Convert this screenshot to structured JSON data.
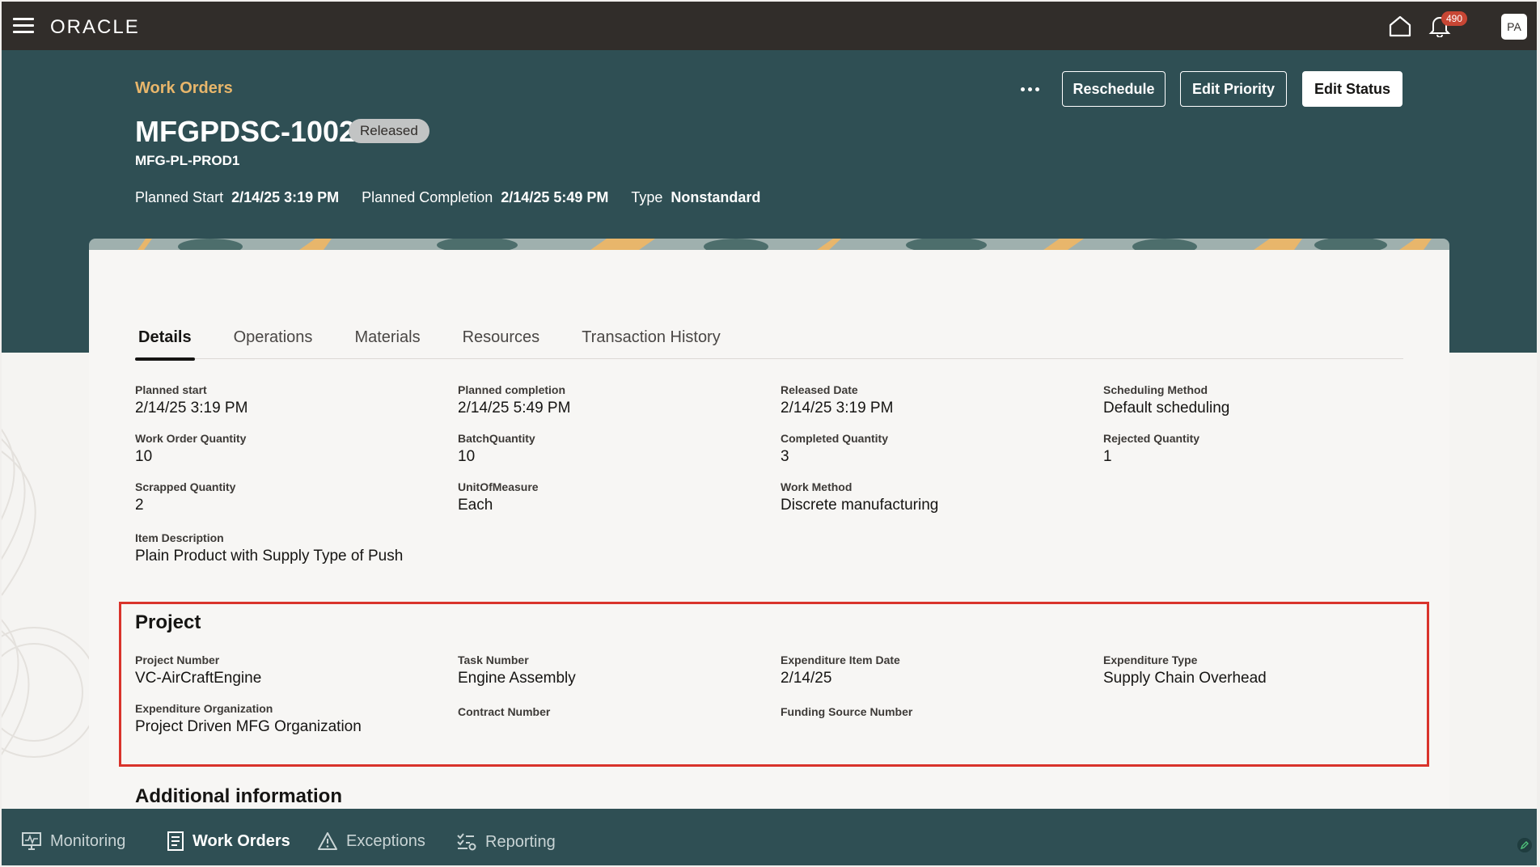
{
  "app": {
    "logo": "ORACLE",
    "notifications_count": "490",
    "user_initials": "PA"
  },
  "header": {
    "breadcrumb": "Work Orders",
    "title": "MFGPDSC-1002",
    "status": "Released",
    "subtitle": "MFG-PL-PROD1",
    "meta": {
      "planned_start_label": "Planned Start",
      "planned_start_value": "2/14/25 3:19 PM",
      "planned_completion_label": "Planned Completion",
      "planned_completion_value": "2/14/25 5:49 PM",
      "type_label": "Type",
      "type_value": "Nonstandard"
    },
    "actions": {
      "reschedule": "Reschedule",
      "edit_priority": "Edit Priority",
      "edit_status": "Edit Status"
    }
  },
  "tabs": [
    "Details",
    "Operations",
    "Materials",
    "Resources",
    "Transaction History"
  ],
  "details": {
    "planned_start": {
      "label": "Planned start",
      "value": "2/14/25 3:19 PM"
    },
    "planned_completion": {
      "label": "Planned completion",
      "value": "2/14/25 5:49 PM"
    },
    "released_date": {
      "label": "Released Date",
      "value": "2/14/25 3:19 PM"
    },
    "scheduling_method": {
      "label": "Scheduling Method",
      "value": "Default scheduling"
    },
    "work_order_quantity": {
      "label": "Work Order Quantity",
      "value": "10"
    },
    "batch_quantity": {
      "label": "BatchQuantity",
      "value": "10"
    },
    "completed_quantity": {
      "label": "Completed Quantity",
      "value": "3"
    },
    "rejected_quantity": {
      "label": "Rejected Quantity",
      "value": "1"
    },
    "scrapped_quantity": {
      "label": "Scrapped Quantity",
      "value": "2"
    },
    "unit_of_measure": {
      "label": "UnitOfMeasure",
      "value": "Each"
    },
    "work_method": {
      "label": "Work Method",
      "value": "Discrete manufacturing"
    },
    "item_description": {
      "label": "Item Description",
      "value": "Plain Product with Supply Type of Push"
    }
  },
  "project": {
    "title": "Project",
    "project_number": {
      "label": "Project Number",
      "value": "VC-AirCraftEngine"
    },
    "task_number": {
      "label": "Task Number",
      "value": "Engine Assembly"
    },
    "expenditure_item_date": {
      "label": "Expenditure Item Date",
      "value": "2/14/25"
    },
    "expenditure_type": {
      "label": "Expenditure Type",
      "value": "Supply Chain Overhead"
    },
    "expenditure_organization": {
      "label": "Expenditure Organization",
      "value": "Project Driven MFG Organization"
    },
    "contract_number": {
      "label": "Contract Number",
      "value": ""
    },
    "funding_source_number": {
      "label": "Funding Source Number",
      "value": ""
    }
  },
  "additional": {
    "title": "Additional information"
  },
  "bottom_nav": {
    "monitoring": "Monitoring",
    "work_orders": "Work Orders",
    "exceptions": "Exceptions",
    "reporting": "Reporting"
  },
  "colors": {
    "topbar": "#312d2a",
    "header_band": "#2f4f54",
    "breadcrumb": "#e8b66b",
    "highlight_border": "#d9332b",
    "badge": "#c74634"
  }
}
